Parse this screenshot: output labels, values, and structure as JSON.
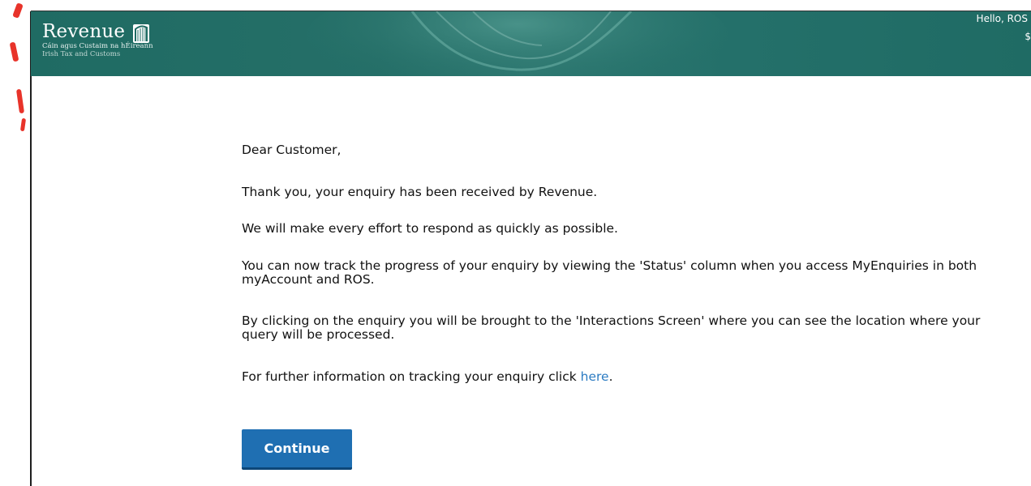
{
  "header": {
    "logo": {
      "word": "Revenue",
      "sub_irish": "Cáin agus Custaim na hÉireann",
      "sub_english": "Irish Tax and Customs",
      "icon": "harp-icon"
    },
    "greeting": "Hello, ROS",
    "greeting_trailing": "$"
  },
  "message": {
    "salutation": "Dear Customer,",
    "received": "Thank you, your enquiry has been received by Revenue.",
    "effort": "We will make every effort to respond as quickly as possible.",
    "track": "You can now track the progress of your enquiry by viewing the 'Status' column when you access MyEnquiries in both myAccount and ROS.",
    "interactions": "By clicking on the enquiry you will be brought to the 'Interactions Screen' where you can see the location where your query will be processed.",
    "further_prefix": "For further information on tracking your enquiry click ",
    "further_link": "here",
    "further_suffix": "."
  },
  "actions": {
    "continue_label": "Continue"
  },
  "colors": {
    "header_bg": "#1f6b63",
    "link": "#2b7bc2",
    "button_bg": "#1f6fb2"
  }
}
